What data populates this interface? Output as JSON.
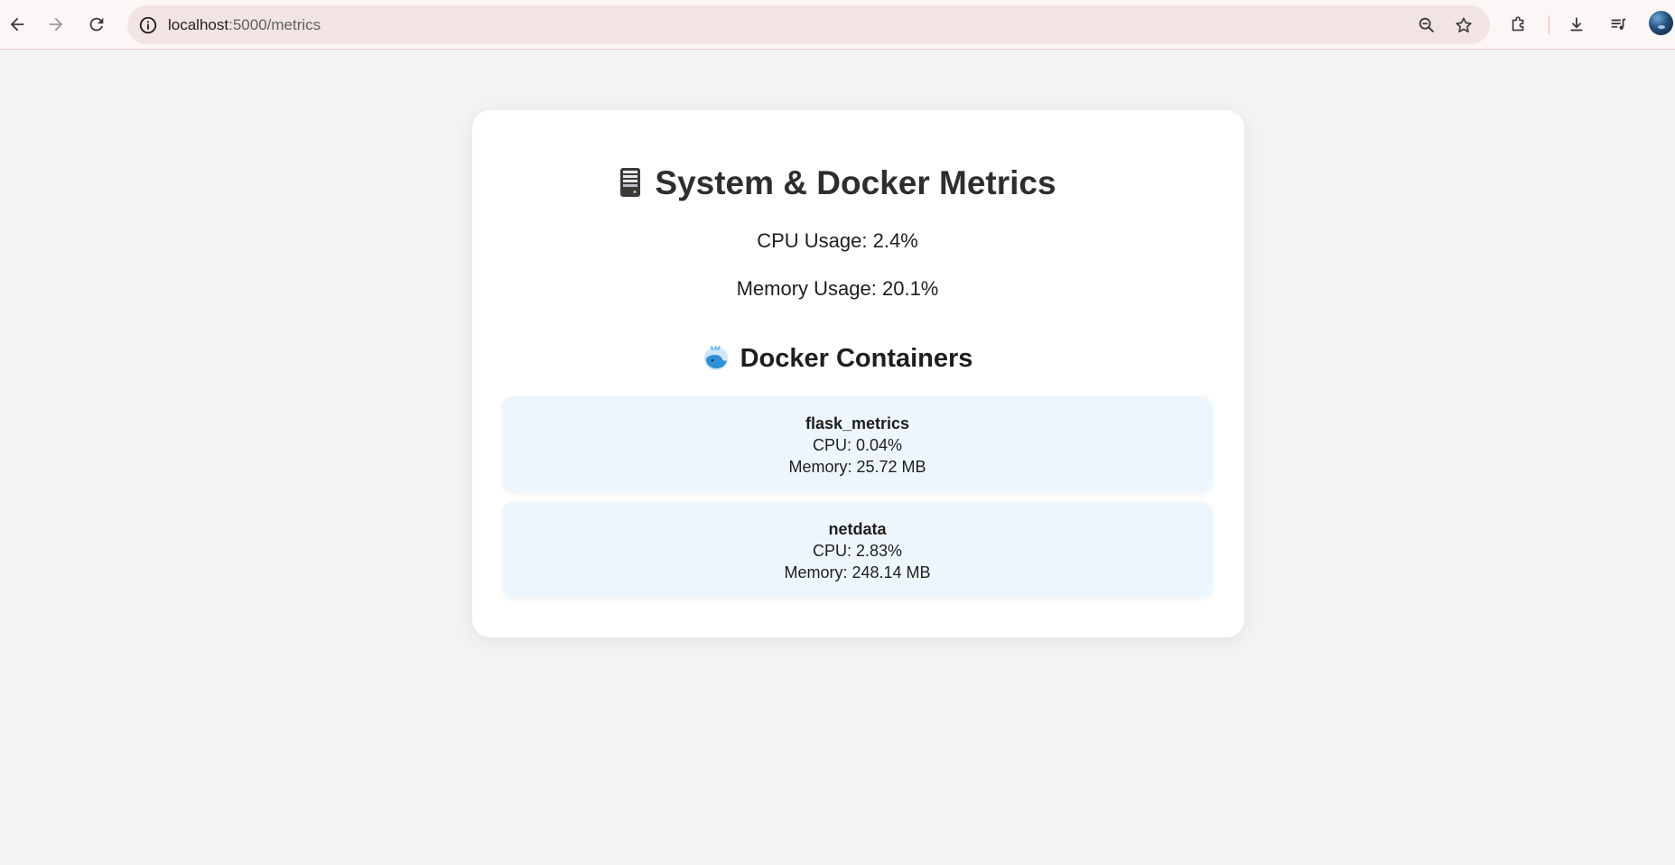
{
  "browser": {
    "url_host": "localhost",
    "url_path": ":5000/metrics"
  },
  "page": {
    "title": "System & Docker Metrics",
    "cpu_usage": "CPU Usage: 2.4%",
    "memory_usage": "Memory Usage: 20.1%",
    "containers_heading": "Docker Containers",
    "containers": [
      {
        "name": "flask_metrics",
        "cpu": "CPU: 0.04%",
        "memory": "Memory: 25.72 MB"
      },
      {
        "name": "netdata",
        "cpu": "CPU: 2.83%",
        "memory": "Memory: 248.14 MB"
      }
    ]
  },
  "icons": {
    "title_icon": "server-icon",
    "containers_icon": "whale-icon"
  },
  "colors": {
    "background": "#f3f3f3",
    "card": "#ffffff",
    "container_card": "#eef6fd",
    "toolbar": "#fdf6f6",
    "omnibox": "#f3e4e4"
  }
}
